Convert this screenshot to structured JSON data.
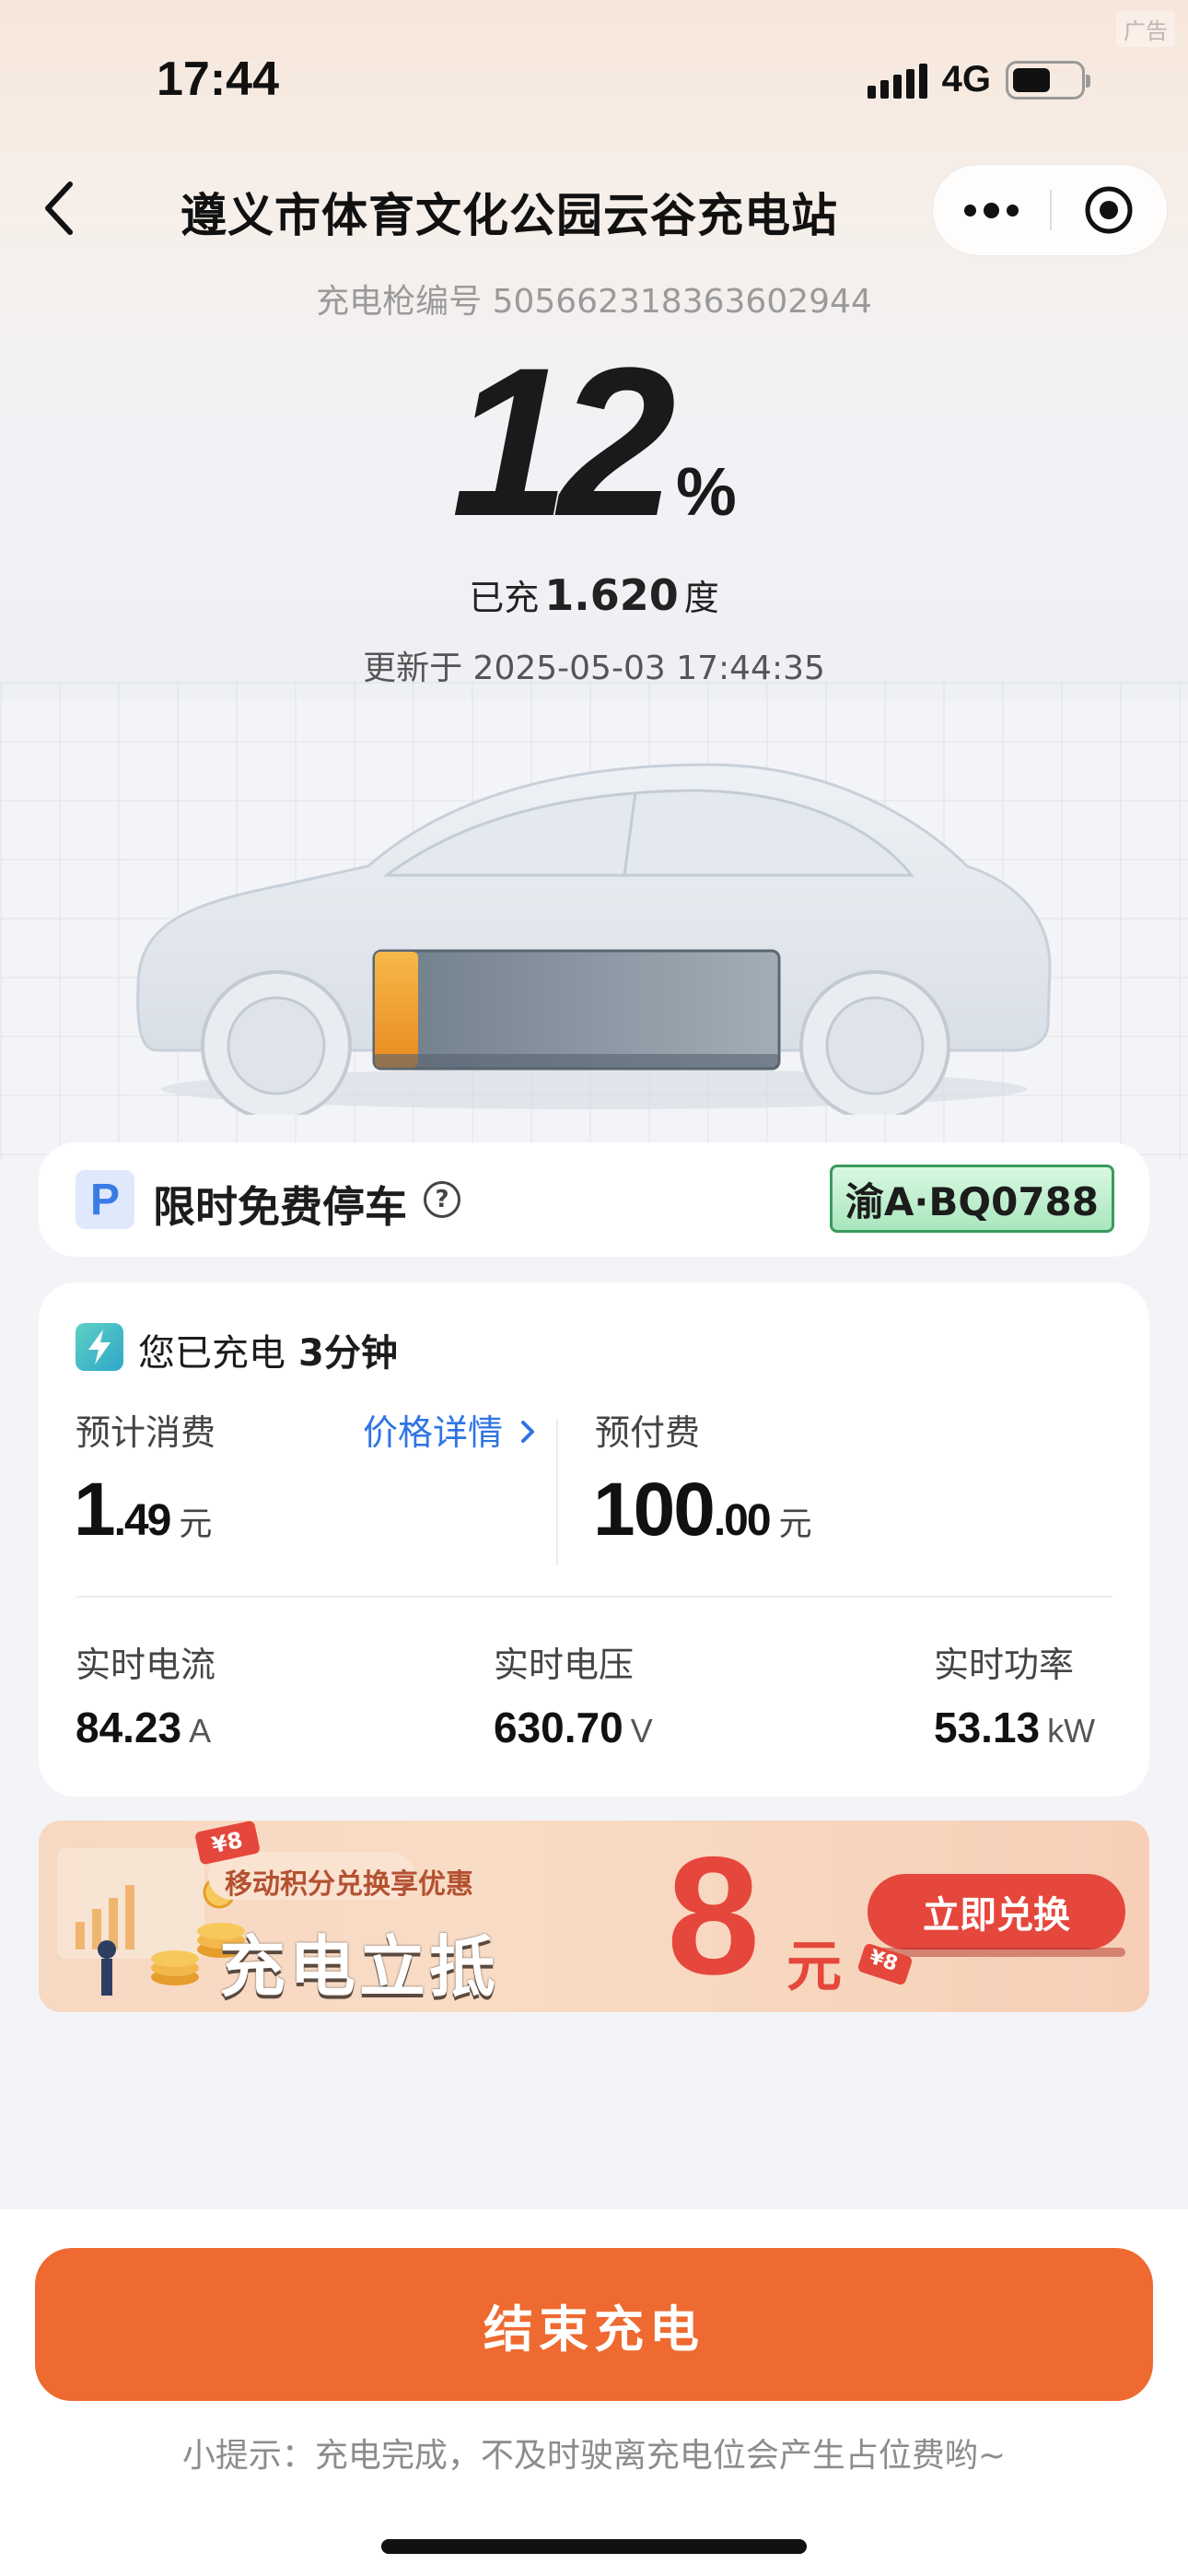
{
  "ad_tag": "广告",
  "status_bar": {
    "time": "17:44",
    "network": "4G"
  },
  "nav": {
    "title": "遵义市体育文化公园云谷充电站"
  },
  "gun": {
    "label": "充电枪编号 505662318363602944"
  },
  "charge": {
    "percent": "12",
    "percent_sign": "%",
    "charged_prefix": "已充",
    "charged_value": "1.620",
    "charged_unit": "度",
    "updated": "更新于 2025-05-03 17:44:35",
    "battery_fill_fraction": 0.12
  },
  "parking": {
    "icon_letter": "P",
    "title": "限时免费停车",
    "help": "?",
    "plate": "渝A·BQ0788"
  },
  "session": {
    "charged_label": "您已充电",
    "duration": "3分钟",
    "est_cost_label": "预计消费",
    "price_detail_link": "价格详情",
    "est_cost_int": "1",
    "est_cost_dec": ".49",
    "currency_unit": "元",
    "prepaid_label": "预付费",
    "prepaid_int": "100",
    "prepaid_dec": ".00",
    "current_label": "实时电流",
    "current_value": "84.23",
    "current_unit": "A",
    "voltage_label": "实时电压",
    "voltage_value": "630.70",
    "voltage_unit": "V",
    "power_label": "实时功率",
    "power_value": "53.13",
    "power_unit": "kW"
  },
  "banner": {
    "small_tag": "¥8",
    "subtitle": "移动积分兑换享优惠",
    "headline": "充电立抵",
    "amount": "8",
    "amount_unit": "元",
    "tag2": "¥8",
    "cta": "立即兑换"
  },
  "footer": {
    "end_button": "结束充电",
    "tip": "小提示：充电完成，不及时驶离充电位会产生占位费哟~"
  },
  "colors": {
    "accent_orange": "#ee6a30",
    "battery_orange": "#f4a12d",
    "link_blue": "#2f74e3",
    "plate_green": "#a9e6bd",
    "banner_red": "#e5473c"
  }
}
